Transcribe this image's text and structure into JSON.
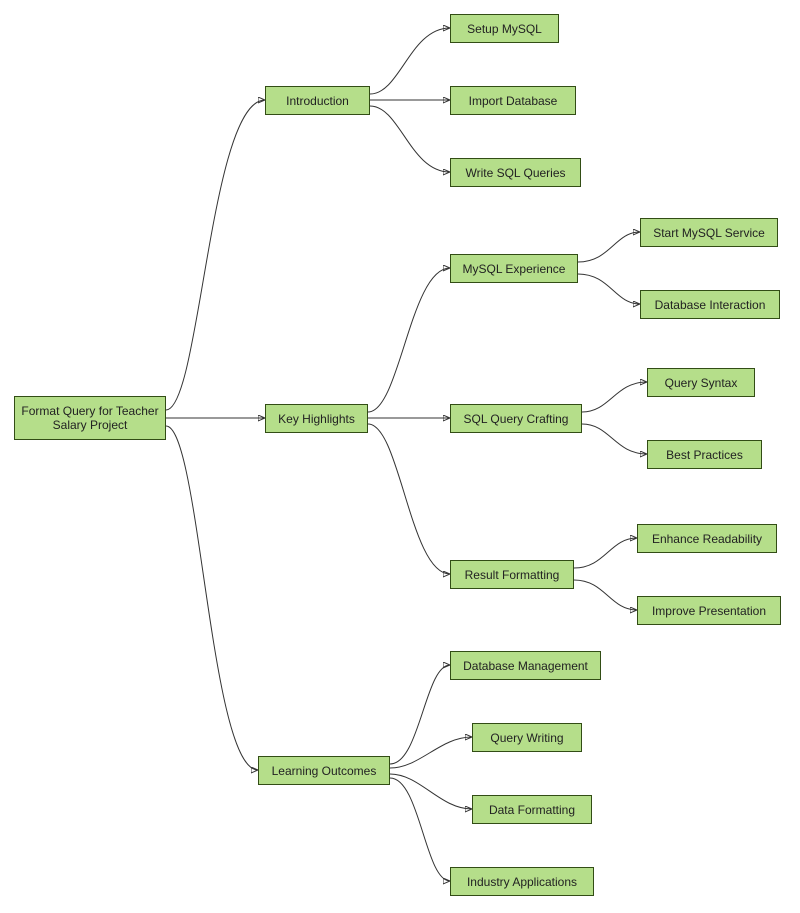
{
  "root": "Format Query for Teacher Salary Project",
  "level1": {
    "intro": "Introduction",
    "highlights": "Key Highlights",
    "outcomes": "Learning Outcomes"
  },
  "intro_children": {
    "setup": "Setup MySQL",
    "import": "Import Database",
    "write": "Write SQL Queries"
  },
  "highlights_children": {
    "mysql": "MySQL Experience",
    "sql": "SQL Query Crafting",
    "format": "Result Formatting"
  },
  "mysql_children": {
    "start": "Start MySQL Service",
    "interact": "Database Interaction"
  },
  "sql_children": {
    "syntax": "Query Syntax",
    "best": "Best Practices"
  },
  "format_children": {
    "read": "Enhance Readability",
    "present": "Improve Presentation"
  },
  "outcomes_children": {
    "db": "Database Management",
    "query": "Query Writing",
    "dataf": "Data Formatting",
    "industry": "Industry Applications"
  }
}
